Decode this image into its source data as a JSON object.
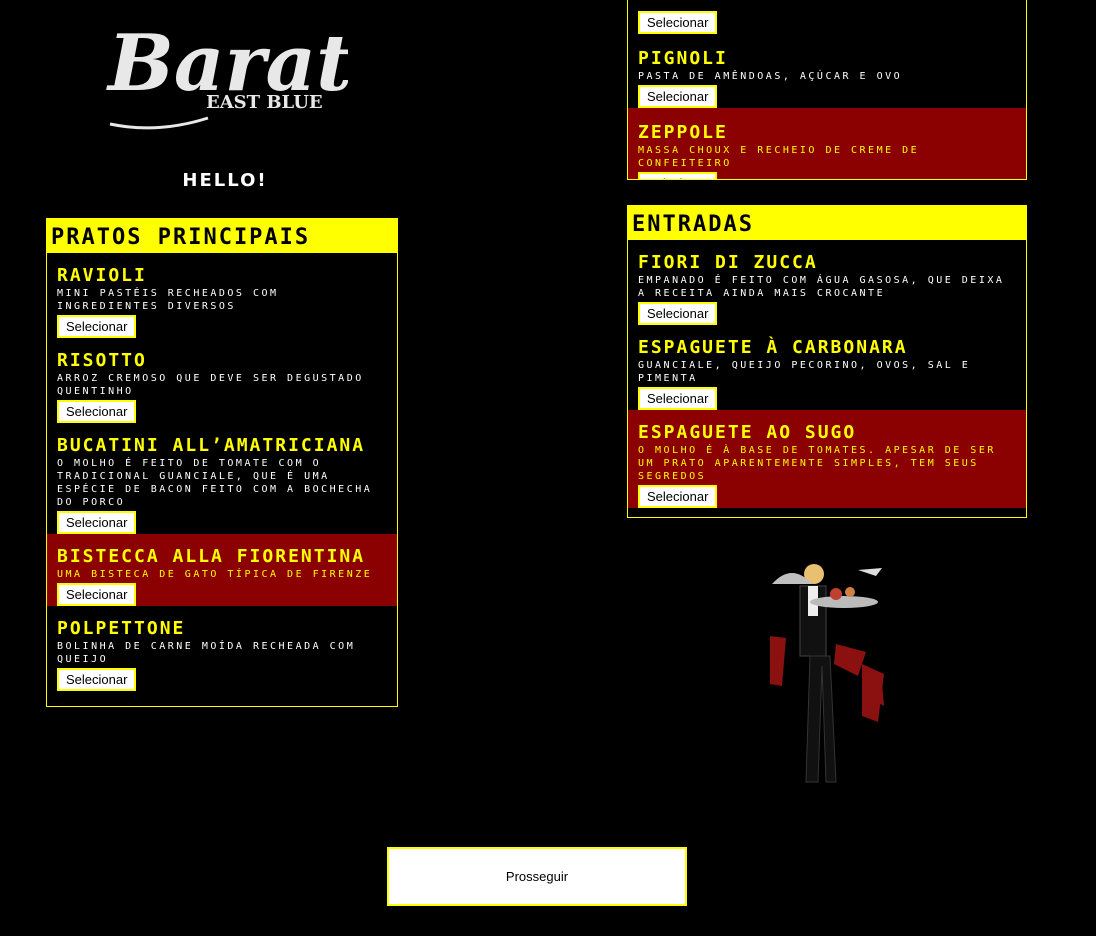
{
  "logo": {
    "brand": "Baratié",
    "subtitle": "EAST BLUE"
  },
  "greeting": "HELLO!",
  "sections": {
    "pratos": {
      "title": "PRATOS PRINCIPAIS",
      "items": [
        {
          "name": "RAVIOLI",
          "desc": "MINI PASTÉIS RECHEADOS COM INGREDIENTES DIVERSOS",
          "button": "Selecionar",
          "highlighted": false
        },
        {
          "name": "RISOTTO",
          "desc": "ARROZ CREMOSO QUE DEVE SER DEGUSTADO QUENTINHO",
          "button": "Selecionar",
          "highlighted": false
        },
        {
          "name": "BUCATINI ALL’AMATRICIANA",
          "desc": "O MOLHO É FEITO DE TOMATE COM O TRADICIONAL GUANCIALE, QUE É UMA ESPÉCIE DE BACON FEITO COM A BOCHECHA DO PORCO",
          "button": "Selecionar",
          "highlighted": false
        },
        {
          "name": "BISTECCA ALLA FIORENTINA",
          "desc": "UMA BISTECA DE GATO TÍPICA DE FIRENZE",
          "button": "Selecionar",
          "highlighted": true
        },
        {
          "name": "POLPETTONE",
          "desc": "BOLINHA DE CARNE MOÍDA RECHEADA COM QUEIJO",
          "button": "Selecionar",
          "highlighted": false
        }
      ]
    },
    "sobremesas": {
      "items": [
        {
          "name": "",
          "desc": "",
          "button": "Selecionar",
          "highlighted": false
        },
        {
          "name": "PIGNOLI",
          "desc": "PASTA DE AMÊNDOAS, AÇÚCAR E OVO",
          "button": "Selecionar",
          "highlighted": false
        },
        {
          "name": "ZEPPOLE",
          "desc": "MASSA CHOUX E RECHEIO DE CREME DE CONFEITEIRO",
          "button": "Selecionar",
          "highlighted": true
        }
      ]
    },
    "entradas": {
      "title": "ENTRADAS",
      "items": [
        {
          "name": "FIORI DI ZUCCA",
          "desc": "EMPANADO É FEITO COM ÁGUA GASOSA, QUE DEIXA A RECEITA AINDA MAIS CROCANTE",
          "button": "Selecionar",
          "highlighted": false
        },
        {
          "name": "ESPAGUETE À CARBONARA",
          "desc": "GUANCIALE, QUEIJO PECORINO, OVOS, SAL E PIMENTA",
          "button": "Selecionar",
          "highlighted": false
        },
        {
          "name": "ESPAGUETE AO SUGO",
          "desc": "O MOLHO É À BASE DE TOMATES. APESAR DE SER UM PRATO APARENTEMENTE SIMPLES, TEM SEUS SEGREDOS",
          "button": "Selecionar",
          "highlighted": true
        }
      ]
    }
  },
  "proceed_button": "Prosseguir",
  "colors": {
    "accent": "#ffff00",
    "highlight": "#8b0000",
    "background": "#000000"
  }
}
